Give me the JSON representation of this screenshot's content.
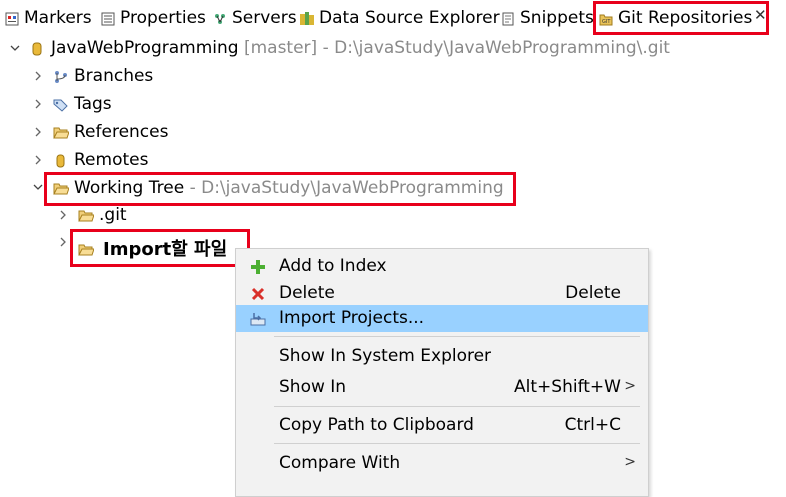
{
  "tabs": [
    {
      "label": "Markers",
      "icon": "markers-icon"
    },
    {
      "label": "Properties",
      "icon": "properties-icon"
    },
    {
      "label": "Servers",
      "icon": "servers-icon"
    },
    {
      "label": "Data Source Explorer",
      "icon": "data-source-icon"
    },
    {
      "label": "Snippets",
      "icon": "snippets-icon"
    },
    {
      "label": "Git Repositories",
      "icon": "git-repo-icon",
      "active": true
    }
  ],
  "tree": {
    "repo": {
      "name": "JavaWebProgramming",
      "branch": "[master]",
      "path": "- D:\\javaStudy\\JavaWebProgramming\\.git"
    },
    "branches": "Branches",
    "tags": "Tags",
    "references": "References",
    "remotes": "Remotes",
    "working_tree": {
      "name": "Working Tree",
      "path": "- D:\\javaStudy\\JavaWebProgramming"
    },
    "git_folder": ".git",
    "import_folder": "Import할 파일"
  },
  "context_menu": {
    "items": [
      {
        "label": "Add to Index",
        "accel": "",
        "icon": "add-icon"
      },
      {
        "label": "Delete",
        "accel": "Delete",
        "icon": "delete-icon"
      },
      {
        "label": "Import Projects...",
        "accel": "",
        "icon": "import-icon",
        "highlighted": true
      },
      {
        "label": "Show In System Explorer",
        "accel": ""
      },
      {
        "label": "Show In",
        "accel": "Alt+Shift+W",
        "submenu": true
      },
      {
        "label": "Copy Path to Clipboard",
        "accel": "Ctrl+C"
      },
      {
        "label": "Compare With",
        "accel": "",
        "submenu": true
      }
    ]
  },
  "colors": {
    "highlight": "#99d1ff",
    "annotation_red": "#e8001b",
    "menu_bg": "#f2f2f2"
  }
}
